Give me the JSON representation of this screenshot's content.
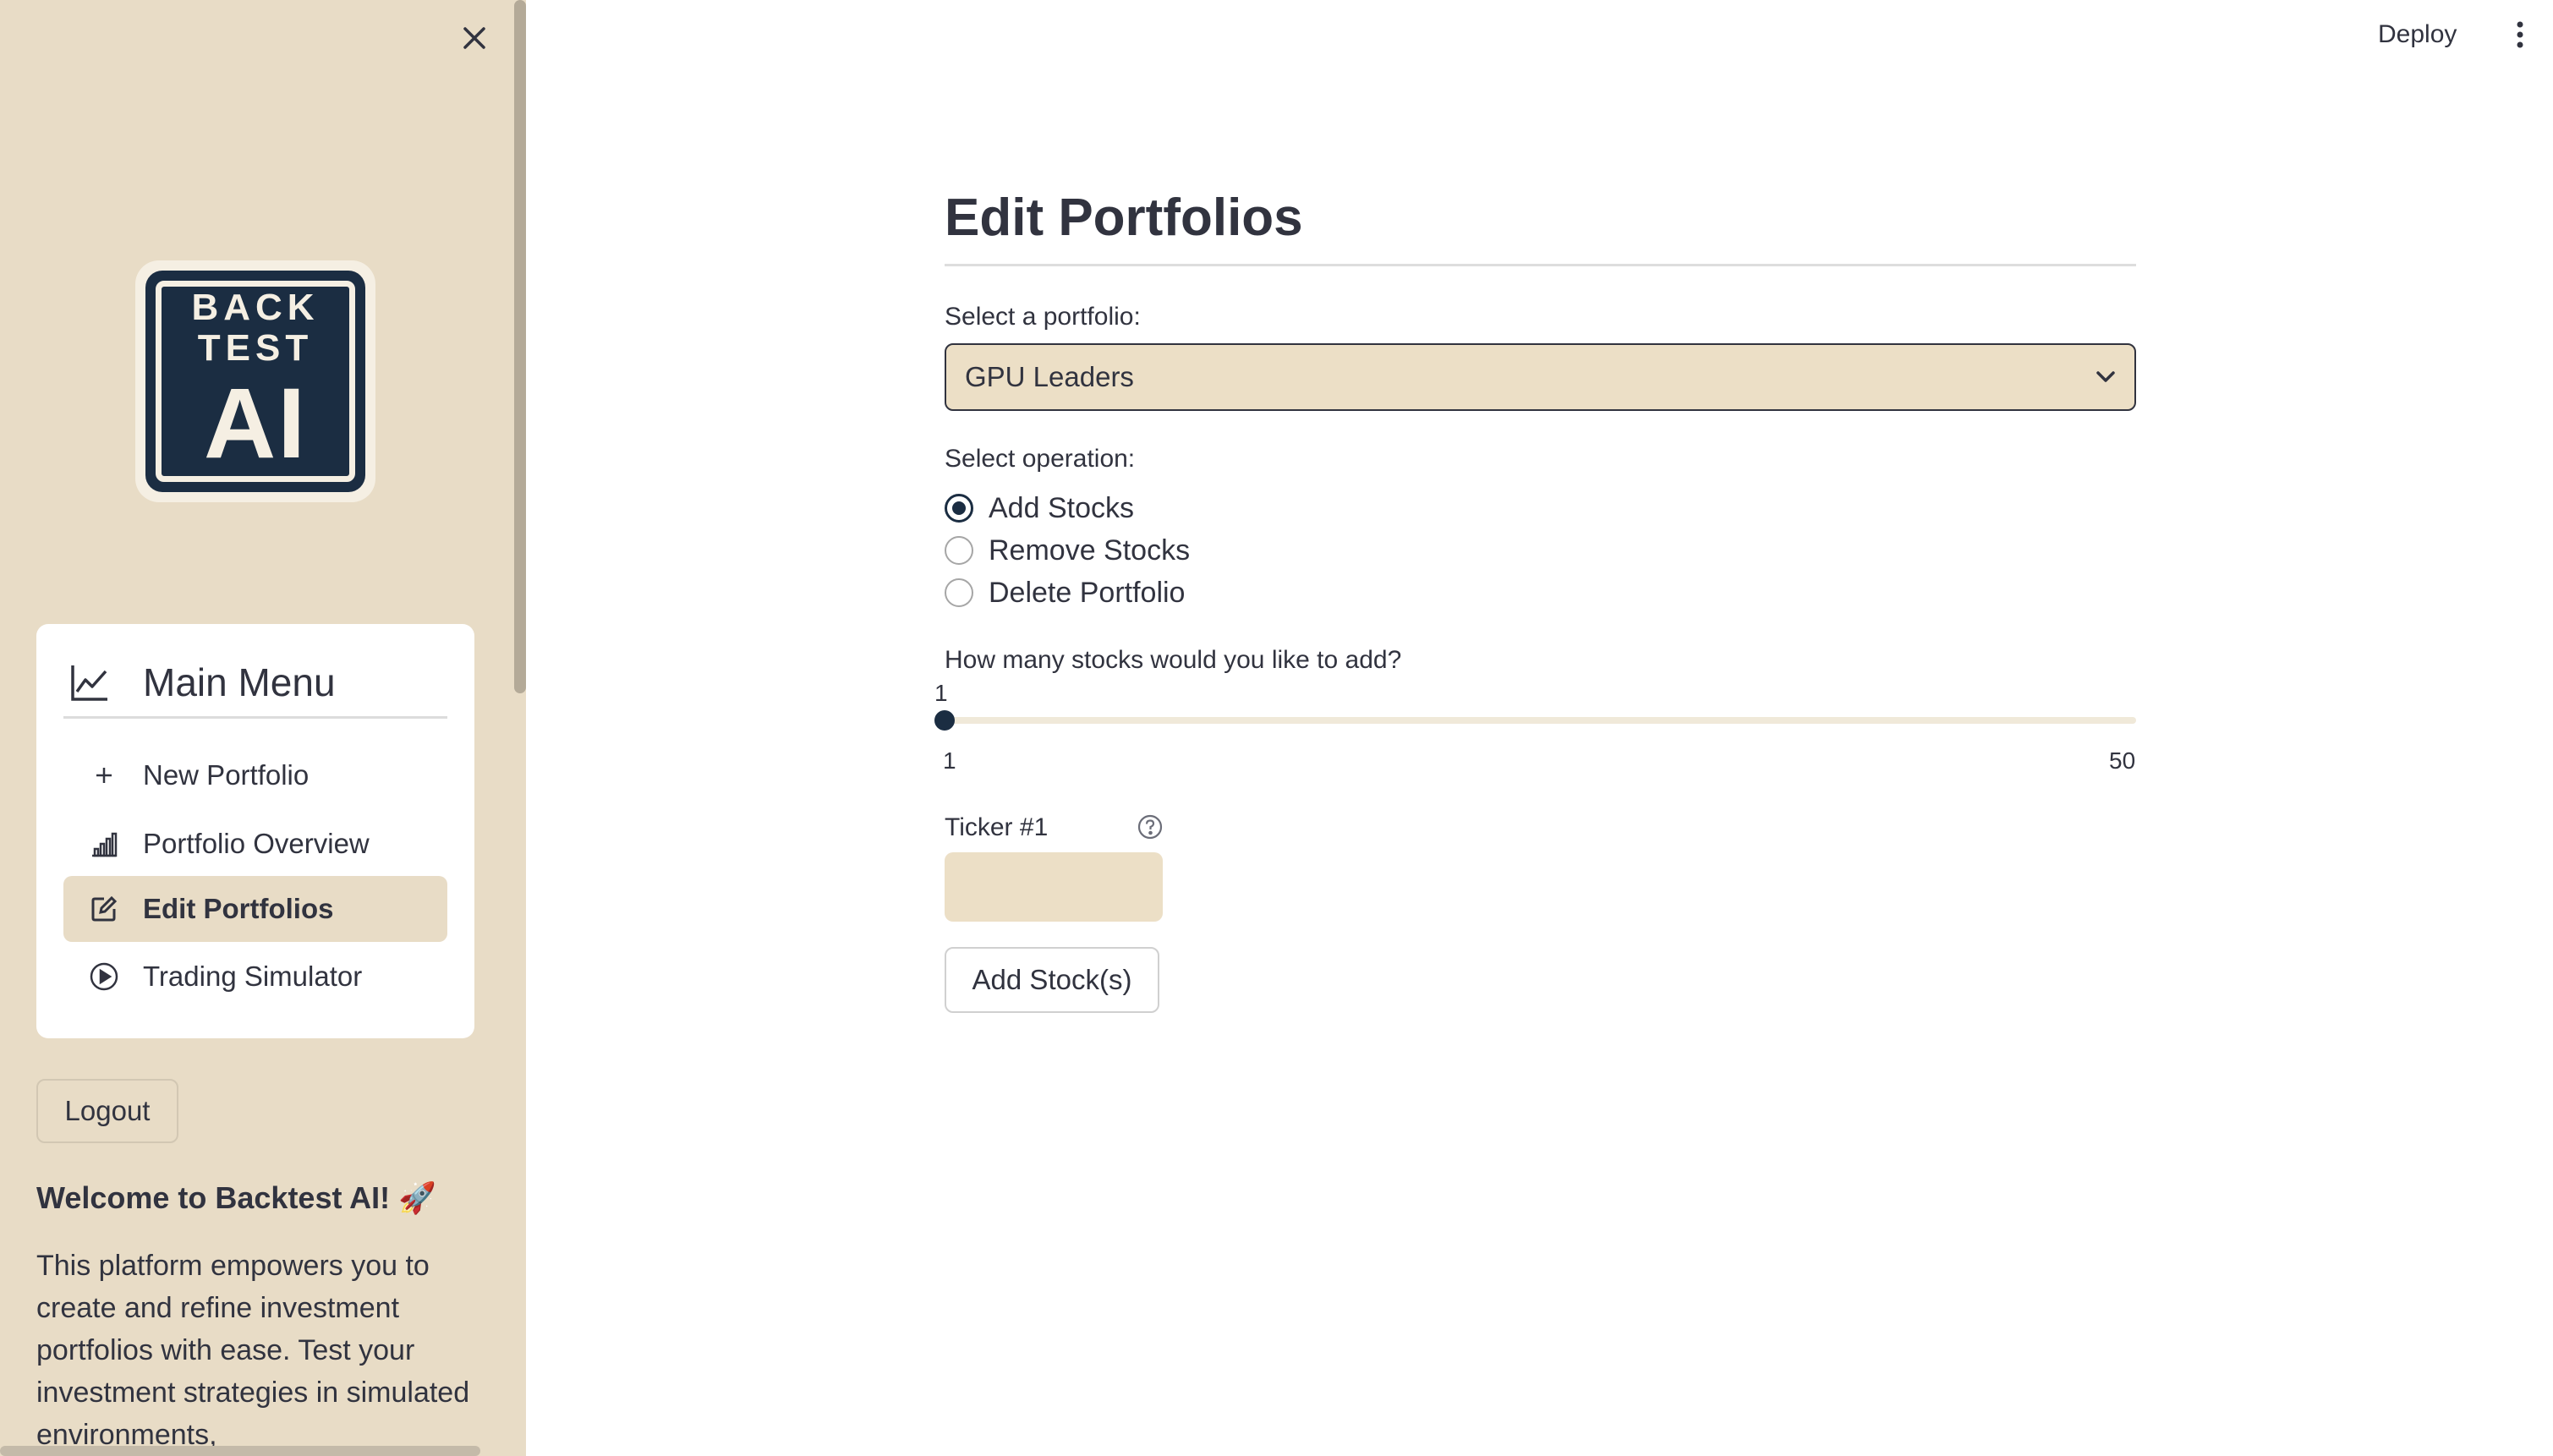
{
  "sidebar": {
    "logo": {
      "line1": "BACK",
      "line2": "TEST",
      "line3": "AI"
    },
    "menu": {
      "title": "Main Menu",
      "items": [
        {
          "label": "New Portfolio",
          "icon": "plus-icon"
        },
        {
          "label": "Portfolio Overview",
          "icon": "bar-chart-icon"
        },
        {
          "label": "Edit Portfolios",
          "icon": "edit-icon",
          "active": true
        },
        {
          "label": "Trading Simulator",
          "icon": "play-circle-icon"
        }
      ]
    },
    "logout_label": "Logout",
    "welcome_title": "Welcome to Backtest AI! 🚀",
    "welcome_text": "This platform empowers you to create and refine investment portfolios with ease. Test your investment strategies in simulated environments,"
  },
  "topbar": {
    "deploy_label": "Deploy"
  },
  "main": {
    "title": "Edit Portfolios",
    "portfolio_label": "Select a portfolio:",
    "portfolio_value": "GPU Leaders",
    "operation_label": "Select operation:",
    "operations": [
      {
        "label": "Add Stocks",
        "selected": true
      },
      {
        "label": "Remove Stocks",
        "selected": false
      },
      {
        "label": "Delete Portfolio",
        "selected": false
      }
    ],
    "slider": {
      "label": "How many stocks would you like to add?",
      "value": "1",
      "min": "1",
      "max": "50"
    },
    "ticker_label": "Ticker #1",
    "ticker_value": "",
    "add_button_label": "Add Stock(s)"
  },
  "colors": {
    "sidebar_bg": "#e8dcc6",
    "accent": "#1b2d42",
    "input_bg": "#ecdfc6",
    "text": "#31333f"
  }
}
